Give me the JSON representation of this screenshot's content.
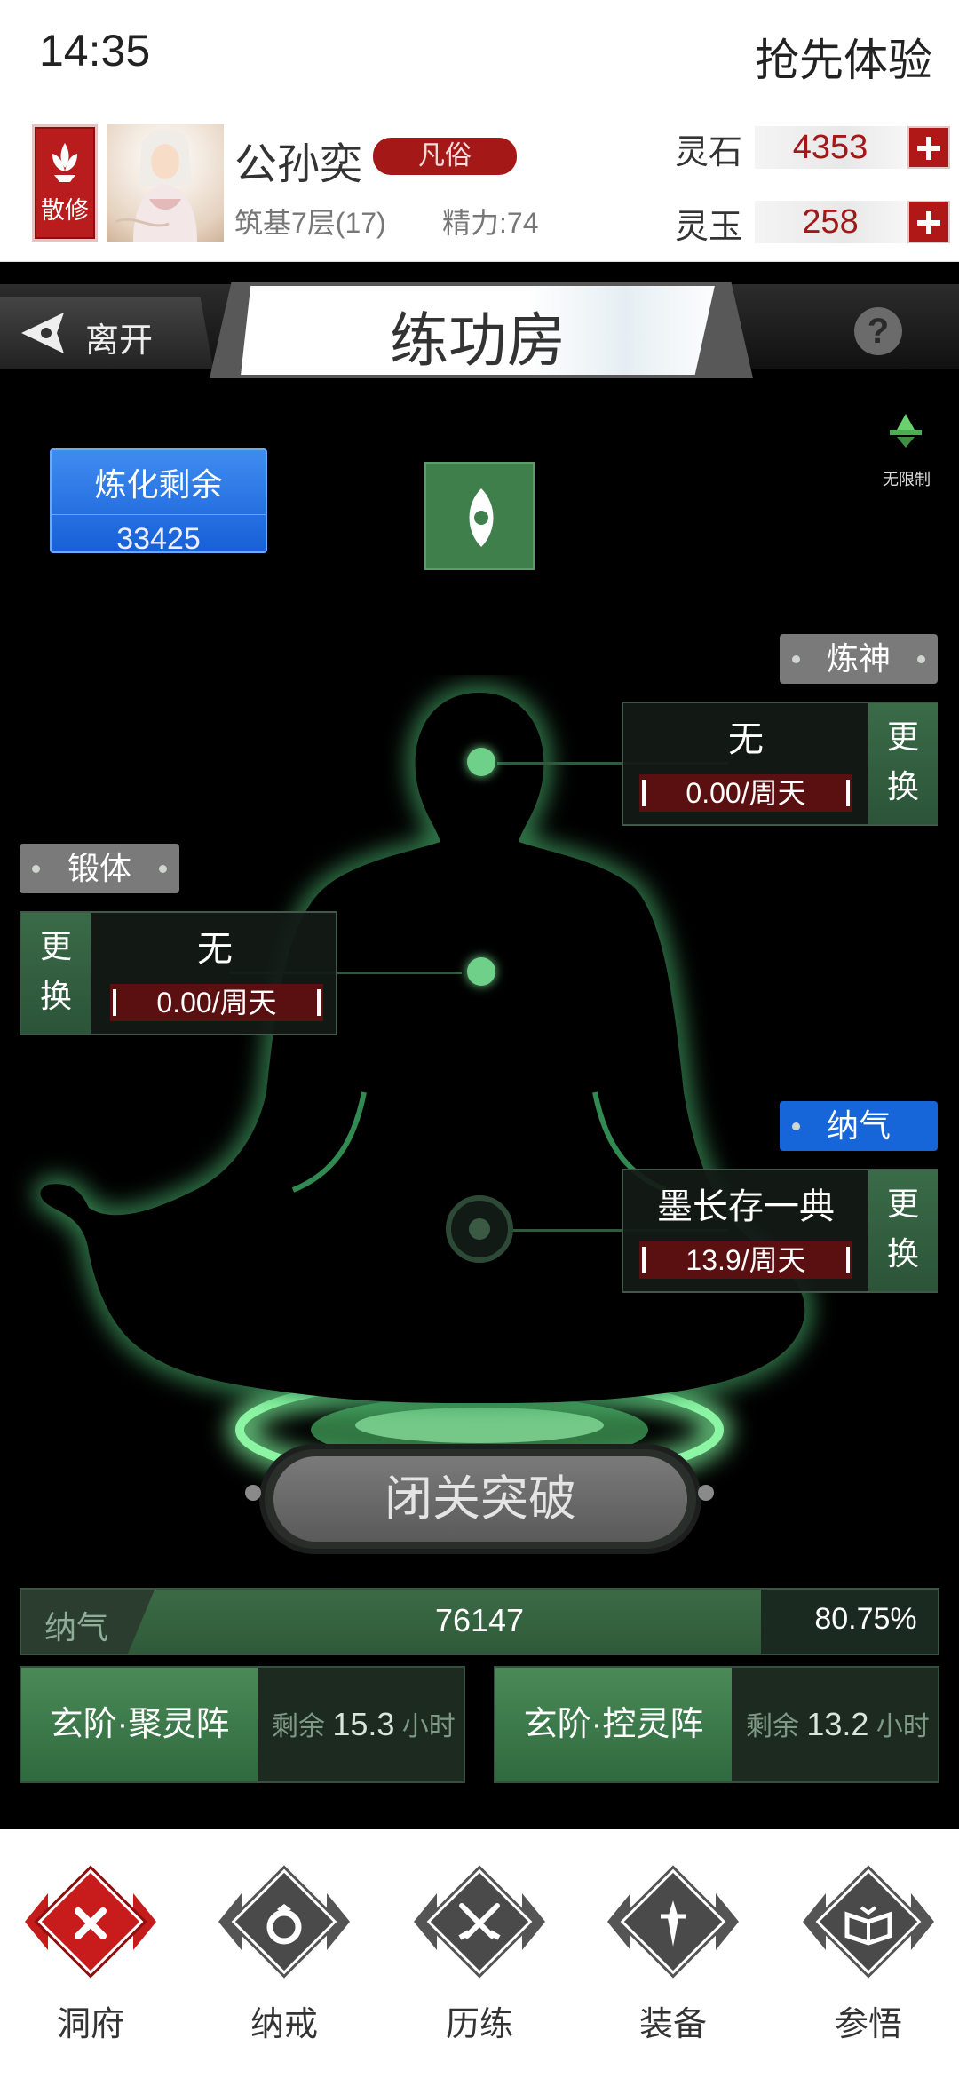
{
  "status_bar": {
    "time": "14:35",
    "right_text": "抢先体验"
  },
  "profile": {
    "sect_label": "散修",
    "name": "公孙奕",
    "rank": "凡俗",
    "realm": "筑基7层(17)",
    "energy": "精力:74",
    "currencies": [
      {
        "label": "灵石",
        "value": "4353"
      },
      {
        "label": "灵玉",
        "value": "258"
      }
    ]
  },
  "title_bar": {
    "leave_label": "离开",
    "title": "练功房",
    "help": "?"
  },
  "refine": {
    "label": "炼化剩余",
    "value": "33425"
  },
  "unlimited_label": "无限制",
  "slots": [
    {
      "tag": "炼神",
      "name": "无",
      "rate": "0.00/周天",
      "swap_1": "更",
      "swap_2": "换"
    },
    {
      "tag": "锻体",
      "name": "无",
      "rate": "0.00/周天",
      "swap_1": "更",
      "swap_2": "换"
    },
    {
      "tag": "纳气",
      "name": "墨长存一典",
      "rate": "13.9/周天",
      "swap_1": "更",
      "swap_2": "换"
    }
  ],
  "breakthrough_label": "闭关突破",
  "qi": {
    "label": "纳气",
    "value": "76147",
    "percent": "80.75%",
    "fraction": 0.8075
  },
  "arrays": [
    {
      "name": "玄阶·聚灵阵",
      "prefix": "剩余",
      "hours": "15.3",
      "unit": "小时"
    },
    {
      "name": "玄阶·控灵阵",
      "prefix": "剩余",
      "hours": "13.2",
      "unit": "小时"
    }
  ],
  "nav": [
    {
      "label": "洞府",
      "icon": "close-x-icon",
      "active": true
    },
    {
      "label": "纳戒",
      "icon": "ring-icon",
      "active": false
    },
    {
      "label": "历练",
      "icon": "crossed-swords-icon",
      "active": false
    },
    {
      "label": "装备",
      "icon": "dagger-icon",
      "active": false
    },
    {
      "label": "参悟",
      "icon": "open-book-icon",
      "active": false
    }
  ],
  "colors": {
    "accent_red": "#b01818",
    "accent_blue": "#1766d9",
    "accent_green": "#3f7f4c",
    "glow_green": "#6fd08a"
  }
}
